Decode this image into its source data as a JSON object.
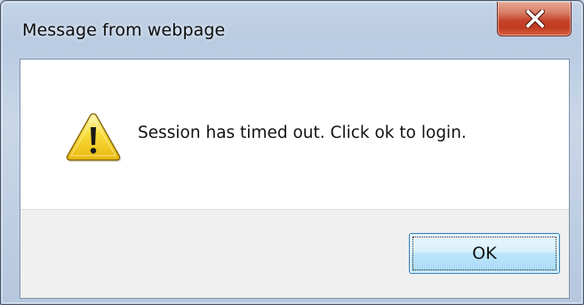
{
  "dialog": {
    "title": "Message from webpage",
    "message": "Session has timed out. Click ok to login.",
    "ok_label": "OK",
    "icons": {
      "warning": "warning-icon",
      "close": "close-icon"
    }
  },
  "colors": {
    "close_button": "#c6452c",
    "warning_fill": "#f5d22a",
    "ok_button_border": "#3c7fb1",
    "button_area_bg": "#f0f0f0"
  }
}
